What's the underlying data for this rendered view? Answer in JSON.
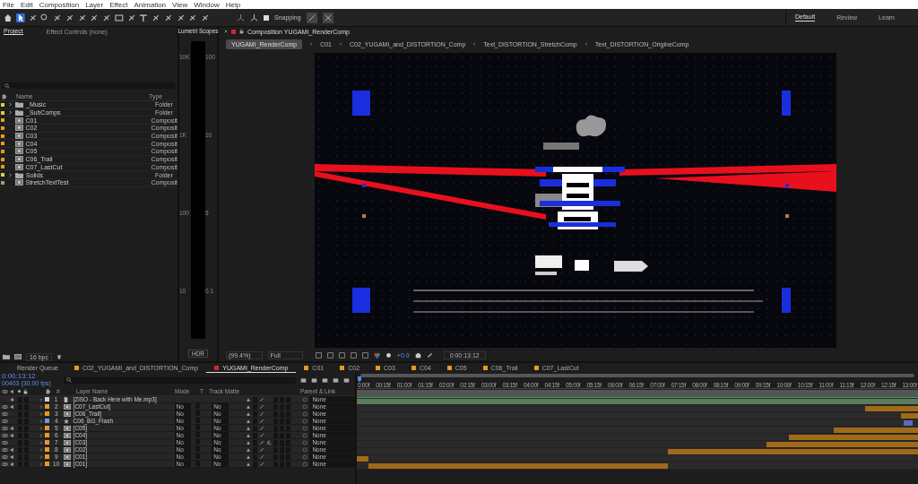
{
  "menu": [
    "File",
    "Edit",
    "Composition",
    "Layer",
    "Effect",
    "Animation",
    "View",
    "Window",
    "Help"
  ],
  "toolbar": {
    "snapping": {
      "label": "Snapping",
      "checked": true
    }
  },
  "workspaces": [
    {
      "label": "Default",
      "selected": true
    },
    {
      "label": "Review",
      "selected": false
    },
    {
      "label": "Learn",
      "selected": false
    }
  ],
  "project_panel": {
    "tabs": [
      {
        "label": "Project",
        "selected": true
      },
      {
        "label": "Effect Controls (none)",
        "selected": false
      }
    ],
    "columns": [
      "Name",
      "Type"
    ],
    "items": [
      {
        "name": "_Music",
        "type": "Folder",
        "kind": "folder",
        "color": "#d8d040"
      },
      {
        "name": "_SubComps",
        "type": "Folder",
        "kind": "folder",
        "color": "#d8d040"
      },
      {
        "name": "C01",
        "type": "Composit",
        "kind": "comp",
        "color": "#e89a20"
      },
      {
        "name": "C02",
        "type": "Composit",
        "kind": "comp",
        "color": "#e89a20"
      },
      {
        "name": "C03",
        "type": "Composit",
        "kind": "comp",
        "color": "#e89a20"
      },
      {
        "name": "C04",
        "type": "Composit",
        "kind": "comp",
        "color": "#e89a20"
      },
      {
        "name": "C05",
        "type": "Composit",
        "kind": "comp",
        "color": "#e89a20"
      },
      {
        "name": "C06_Trail",
        "type": "Composit",
        "kind": "comp",
        "color": "#e89a20"
      },
      {
        "name": "C07_LastCut",
        "type": "Composit",
        "kind": "comp",
        "color": "#e89a20"
      },
      {
        "name": "Solids",
        "type": "Folder",
        "kind": "folder",
        "color": "#d8d040"
      },
      {
        "name": "StretchTextTest",
        "type": "Composit",
        "kind": "comp",
        "color": "#a89880"
      }
    ],
    "bit_depth": "16 bpc"
  },
  "lumetri": {
    "title": "Lumetri Scopes",
    "left_scale": [
      "10K",
      "1K",
      "100",
      "10"
    ],
    "right_scale": [
      "100",
      "10",
      "5",
      "0.1"
    ],
    "mode": "HDR"
  },
  "composition": {
    "title": "Composition YUGAMI_RenderComp",
    "breadcrumbs": [
      {
        "label": "YUGAMI_RenderComp",
        "selected": true
      },
      {
        "label": "C01",
        "selected": false
      },
      {
        "label": "C02_YUGAMI_and_DISTORTION_Comp",
        "selected": false
      },
      {
        "label": "Text_DISTORTION_StretchComp",
        "selected": false
      },
      {
        "label": "Text_DISTORTION_OrigineComp",
        "selected": false
      }
    ],
    "zoom": "(99.4%)",
    "resolution": "Full",
    "exposure": "+0.0",
    "timecode": "0:00:13:12"
  },
  "timeline": {
    "tabs": [
      {
        "label": "Render Queue",
        "kind": "queue",
        "selected": false
      },
      {
        "label": "C02_YUGAMI_and_DISTORTION_Comp",
        "kind": "comp",
        "selected": false
      },
      {
        "label": "YUGAMI_RenderComp",
        "kind": "comp",
        "selected": true
      },
      {
        "label": "C01",
        "kind": "comp",
        "selected": false
      },
      {
        "label": "C02",
        "kind": "comp",
        "selected": false
      },
      {
        "label": "C03",
        "kind": "comp",
        "selected": false
      },
      {
        "label": "C04",
        "kind": "comp",
        "selected": false
      },
      {
        "label": "C05",
        "kind": "comp",
        "selected": false
      },
      {
        "label": "C06_Trail",
        "kind": "comp",
        "selected": false
      },
      {
        "label": "C07_LastCut",
        "kind": "comp",
        "selected": false
      }
    ],
    "timecode": "0:00:13:12",
    "frames": "00403 (30.00 fps)",
    "columns": {
      "number": "#",
      "name": "Layer Name",
      "mode": "Mode",
      "t": "T",
      "matte": "Track Matte",
      "parent": "Parent & Link"
    },
    "ruler": [
      "0:00f",
      "00:15f",
      "01:00f",
      "01:15f",
      "02:00f",
      "02:15f",
      "03:00f",
      "03:15f",
      "04:00f",
      "04:15f",
      "05:00f",
      "05:15f",
      "06:00f",
      "06:15f",
      "07:00f",
      "07:15f",
      "08:00f",
      "08:15f",
      "09:00f",
      "09:15f",
      "10:00f",
      "10:15f",
      "11:00f",
      "11:15f",
      "12:00f",
      "12:15f",
      "13:00f"
    ],
    "layers": [
      {
        "number": "1",
        "name": "[ZiSO - Back Here with Me.mp3]",
        "kind": "audio",
        "color": "#c8d4c0",
        "visible": false,
        "audio": true,
        "effects": false,
        "parent": "None"
      },
      {
        "number": "2",
        "name": "[C07_LastCut]",
        "kind": "comp",
        "color": "#e89a20",
        "visible": true,
        "audio": true,
        "effects": false,
        "mode": "No",
        "matte": "No",
        "parent": "None"
      },
      {
        "number": "3",
        "name": "[C06_Trail]",
        "kind": "comp",
        "color": "#e89a20",
        "visible": true,
        "audio": false,
        "effects": false,
        "mode": "No",
        "matte": "No",
        "parent": "None"
      },
      {
        "number": "4",
        "name": "C06_BG_Flash",
        "kind": "shape",
        "color": "#7a8ee8",
        "visible": true,
        "audio": false,
        "effects": false,
        "mode": "No",
        "matte": "No",
        "parent": "None"
      },
      {
        "number": "5",
        "name": "[C05]",
        "kind": "comp",
        "color": "#e89a20",
        "visible": true,
        "audio": true,
        "effects": false,
        "mode": "No",
        "matte": "No",
        "parent": "None"
      },
      {
        "number": "6",
        "name": "[C04]",
        "kind": "comp",
        "color": "#e89a20",
        "visible": true,
        "audio": true,
        "effects": false,
        "mode": "No",
        "matte": "No",
        "parent": "None"
      },
      {
        "number": "7",
        "name": "[C03]",
        "kind": "comp",
        "color": "#e89a20",
        "visible": true,
        "audio": false,
        "effects": true,
        "mode": "No",
        "matte": "No",
        "parent": "None"
      },
      {
        "number": "8",
        "name": "[C02]",
        "kind": "comp",
        "color": "#e89a20",
        "visible": true,
        "audio": true,
        "effects": false,
        "mode": "No",
        "matte": "No",
        "parent": "None"
      },
      {
        "number": "9",
        "name": "[C01]",
        "kind": "comp",
        "color": "#e89a20",
        "visible": true,
        "audio": true,
        "effects": false,
        "mode": "No",
        "matte": "No",
        "parent": "None"
      },
      {
        "number": "10",
        "name": "[C01]",
        "kind": "comp",
        "color": "#e89a20",
        "visible": true,
        "audio": true,
        "effects": false,
        "mode": "No",
        "matte": "No",
        "parent": "None"
      }
    ]
  }
}
